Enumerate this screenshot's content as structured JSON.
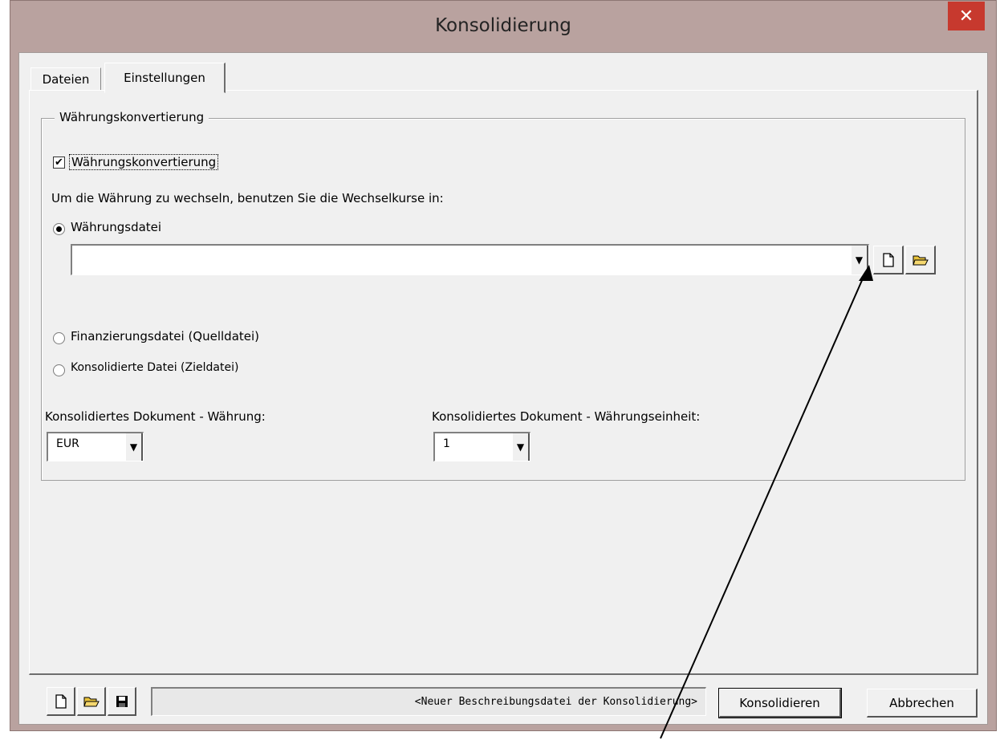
{
  "window": {
    "title": "Konsolidierung",
    "close_glyph": "✕"
  },
  "tabs": [
    {
      "label": "Dateien",
      "active": false
    },
    {
      "label": "Einstellungen",
      "active": true
    }
  ],
  "group": {
    "legend": "Währungskonvertierung",
    "checkbox": {
      "label": "Währungskonvertierung",
      "checked": true,
      "glyph": "✔"
    },
    "instruction": "Um die Währung zu wechseln, benutzen Sie die Wechselkurse in:",
    "radios": [
      {
        "label": "Währungsdatei",
        "selected": true
      },
      {
        "label": "Finanzierungsdatei (Quelldatei)",
        "selected": false
      },
      {
        "label": "Konsolidierte Datei (Zieldatei)",
        "selected": false
      }
    ],
    "currency_file_value": "",
    "currency": {
      "label": "Konsolidiertes Dokument - Währung:",
      "value": "EUR"
    },
    "unit": {
      "label": "Konsolidiertes Dokument - Währungseinheit:",
      "value": "1"
    }
  },
  "footer": {
    "status": "<Neuer Beschreibungsdatei der Konsolidierung>",
    "consolidate_label": "Konsolidieren",
    "cancel_label": "Abbrechen"
  },
  "icons": [
    "new-file-icon",
    "open-folder-icon",
    "save-icon",
    "dropdown-arrow-icon"
  ]
}
